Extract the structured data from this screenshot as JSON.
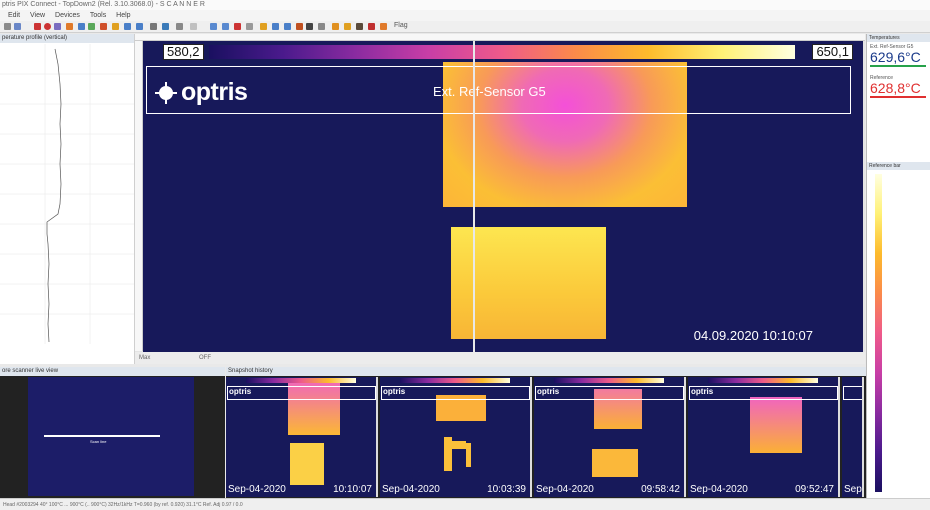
{
  "window": {
    "title": "ptris PIX Connect - TopDown2 (Rel. 3.10.3068.0) - S C A N N E R"
  },
  "menu": [
    "Edit",
    "View",
    "Devices",
    "Tools",
    "Help"
  ],
  "toolbar": {
    "flag_label": "Flag"
  },
  "profile_panel": {
    "title": "perature profile (vertical)"
  },
  "main": {
    "palette_min": "580,2",
    "palette_max": "650,1",
    "logo_text": "optris",
    "sensor_label": "Ext. Ref-Sensor G5",
    "timestamp": "04.09.2020 10:10:07",
    "footer_items": [
      "Max",
      "OFF"
    ]
  },
  "temperatures_panel": {
    "title": "Temperatures",
    "readings": [
      {
        "label": "Ext. Ref-Sensor G5",
        "value": "629,6°C",
        "color": "#1a3a8a",
        "bar_color": "#27a24a"
      },
      {
        "label": "Reference",
        "value": "628,8°C",
        "color": "#e03030",
        "bar_color": "#e03030"
      }
    ]
  },
  "reference_bar": {
    "title": "Reference bar"
  },
  "live_view": {
    "title": "ore scanner live view",
    "scanline_label": "Scan line"
  },
  "history": {
    "title": "Snapshot history",
    "snapshots": [
      {
        "date": "Sep-04-2020",
        "time": "10:10:07"
      },
      {
        "date": "Sep-04-2020",
        "time": "10:03:39"
      },
      {
        "date": "Sep-04-2020",
        "time": "09:58:42"
      },
      {
        "date": "Sep-04-2020",
        "time": "09:52:47"
      },
      {
        "date": "Sep"
      }
    ]
  },
  "status": {
    "text": "Head #2003294    40°    100°C ... 900°C (.. 900°C)    32Hz/1kHz    T=0.960 (by ref. 0.920)    31.1°C    Ref. Adj 0.97 / 0.0"
  },
  "colors": {
    "thermal_background": "#17195a",
    "hot_magenta": "#f450d8",
    "hot_yellow": "#fde650"
  }
}
